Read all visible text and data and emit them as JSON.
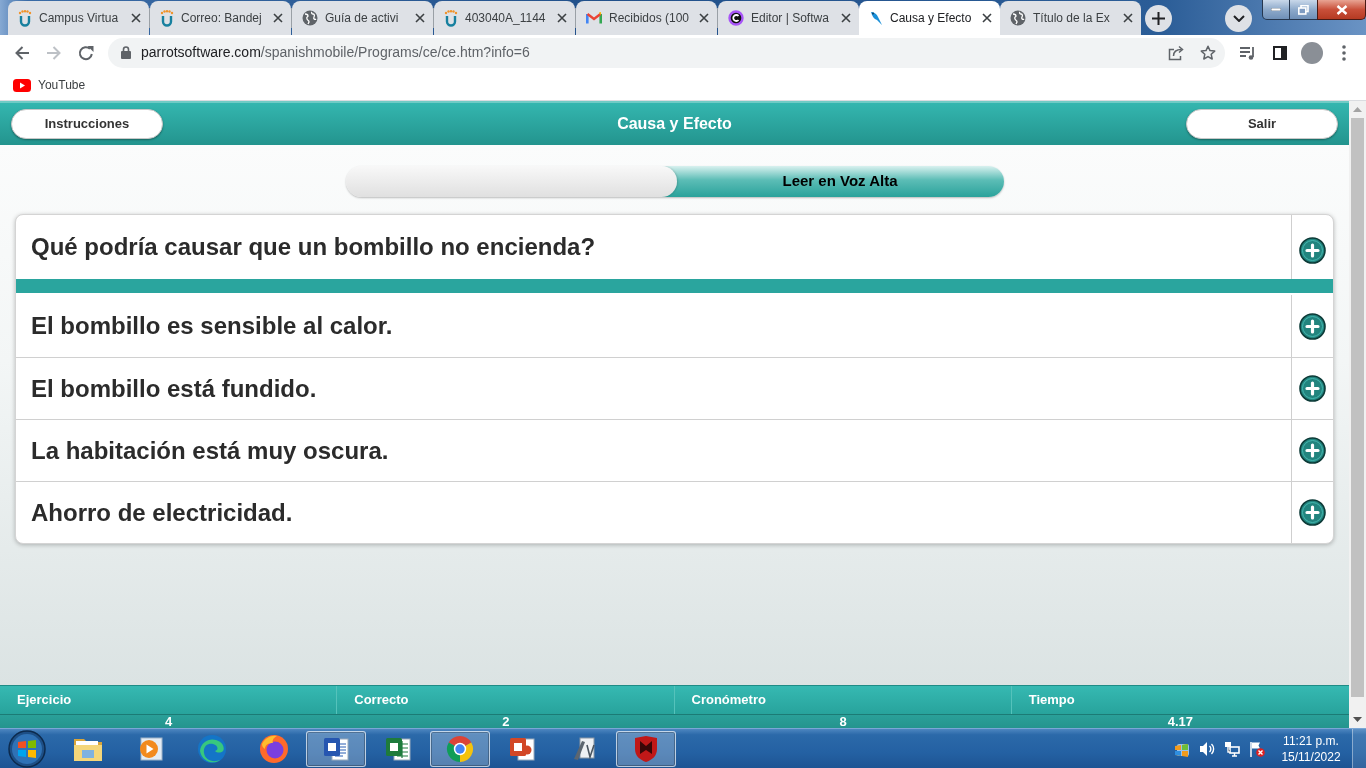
{
  "browser": {
    "tabs": [
      {
        "kind": "campus",
        "title": "Campus Virtua",
        "selected": false
      },
      {
        "kind": "campus",
        "title": "Correo: Bandej",
        "selected": false
      },
      {
        "kind": "globe",
        "title": "Guía de activi",
        "selected": false
      },
      {
        "kind": "campus",
        "title": "403040A_1144",
        "selected": false
      },
      {
        "kind": "gmail",
        "title": "Recibidos (100",
        "selected": false
      },
      {
        "kind": "ring",
        "title": "Editor | Softwa",
        "selected": false
      },
      {
        "kind": "bird",
        "title": "Causa y Efecto",
        "selected": true
      },
      {
        "kind": "globe",
        "title": "Título de la Ex",
        "selected": false
      }
    ],
    "address": {
      "host": "parrotsoftware.com",
      "path": "/spanishmobile/Programs/ce/ce.htm?info=6"
    },
    "bookmarks": [
      {
        "label": "YouTube"
      }
    ]
  },
  "app": {
    "header": {
      "left_button": "Instrucciones",
      "title": "Causa y Efecto",
      "right_button": "Salir"
    },
    "read_aloud": {
      "label": "Leer en Voz Alta",
      "on": true
    },
    "question": "Qué podría causar que un bombillo no encienda?",
    "answers": [
      "El bombillo es sensible al calor.",
      "El bombillo está fundido.",
      "La habitación está muy oscura.",
      "Ahorro de electricidad."
    ],
    "stats": [
      {
        "label": "Ejercicio",
        "value": "4"
      },
      {
        "label": "Correcto",
        "value": "2"
      },
      {
        "label": "Cronómetro",
        "value": "8"
      },
      {
        "label": "Tiempo",
        "value": "4.17"
      }
    ]
  },
  "taskbar": {
    "apps": [
      {
        "kind": "folder",
        "active": false
      },
      {
        "kind": "media",
        "active": false
      },
      {
        "kind": "swirl",
        "active": false
      },
      {
        "kind": "flame",
        "active": false
      },
      {
        "kind": "document",
        "active": true
      },
      {
        "kind": "spreadsheet",
        "active": false
      },
      {
        "kind": "wheel",
        "active": true
      },
      {
        "kind": "presentation",
        "active": false
      },
      {
        "kind": "pen",
        "active": false
      },
      {
        "kind": "shield",
        "active": true
      }
    ],
    "clock": {
      "time": "11:21 p.m.",
      "date": "15/11/2022"
    }
  }
}
